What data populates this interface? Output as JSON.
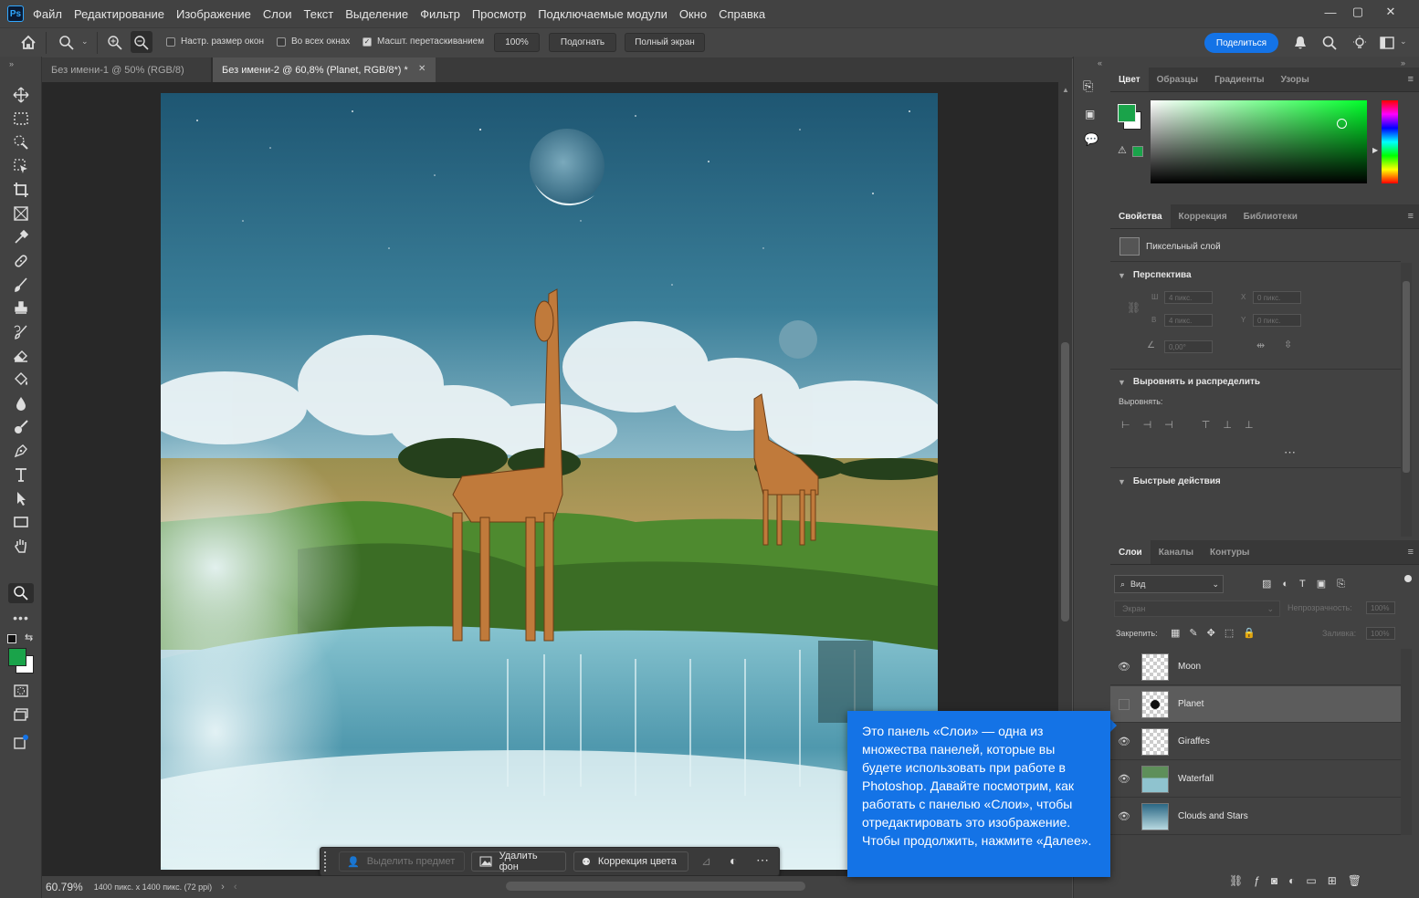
{
  "app": {
    "logo": "Ps"
  },
  "menu": [
    "Файл",
    "Редактирование",
    "Изображение",
    "Слои",
    "Текст",
    "Выделение",
    "Фильтр",
    "Просмотр",
    "Подключаемые модули",
    "Окно",
    "Справка"
  ],
  "options": {
    "resize_windows": "Настр. размер окон",
    "all_windows": "Во всех окнах",
    "scrubby_zoom": "Масшт. перетаскиванием",
    "zoom_value": "100%",
    "fit_button": "Подогнать",
    "fullscreen_button": "Полный экран",
    "share_button": "Поделиться"
  },
  "tabs": [
    {
      "label": "Без имени-1 @ 50% (RGB/8)",
      "active": false
    },
    {
      "label": "Без имени-2 @ 60,8% (Planet, RGB/8*) *",
      "active": true
    }
  ],
  "status": {
    "zoom": "60.79%",
    "doc_info": "1400 пикс. x 1400 пикс. (72 ppi)"
  },
  "contextbar": {
    "select_subject": "Выделить предмет",
    "remove_bg": "Удалить фон",
    "color_correct": "Коррекция цвета"
  },
  "color_panel": {
    "tabs": [
      "Цвет",
      "Образцы",
      "Градиенты",
      "Узоры"
    ],
    "foreground": "#1aa34a",
    "background": "#ffffff"
  },
  "properties_panel": {
    "tabs": [
      "Свойства",
      "Коррекция",
      "Библиотеки"
    ],
    "layer_type": "Пиксельный слой",
    "perspective": "Перспектива",
    "w_label": "Ш",
    "w_value": "4 пикс.",
    "h_label": "В",
    "h_value": "4 пикс.",
    "x_label": "X",
    "x_value": "0 пикс.",
    "y_label": "Y",
    "y_value": "0 пикс.",
    "angle_value": "0,00°",
    "align_section": "Выровнять и распределить",
    "align_label": "Выровнять:",
    "quick_actions": "Быстрые действия"
  },
  "layers_panel": {
    "tabs": [
      "Слои",
      "Каналы",
      "Контуры"
    ],
    "filter_kind": "Вид",
    "blend_mode": "Экран",
    "opacity_label": "Непрозрачность:",
    "opacity_value": "100%",
    "lock_label": "Закрепить:",
    "fill_label": "Заливка:",
    "fill_value": "100%",
    "layers": [
      {
        "name": "Moon",
        "visible": true,
        "selected": false
      },
      {
        "name": "Planet",
        "visible": false,
        "selected": true
      },
      {
        "name": "Giraffes",
        "visible": true,
        "selected": false
      },
      {
        "name": "Waterfall",
        "visible": true,
        "selected": false
      },
      {
        "name": "Clouds and Stars",
        "visible": true,
        "selected": false
      }
    ]
  },
  "coachmark": {
    "text": "Это панель «Слои» — одна из множества панелей, которые вы будете использовать при работе в Photoshop. Давайте посмотрим, как работать с панелью «Слои», чтобы отредактировать это изображение. Чтобы продолжить, нажмите «Далее»."
  }
}
